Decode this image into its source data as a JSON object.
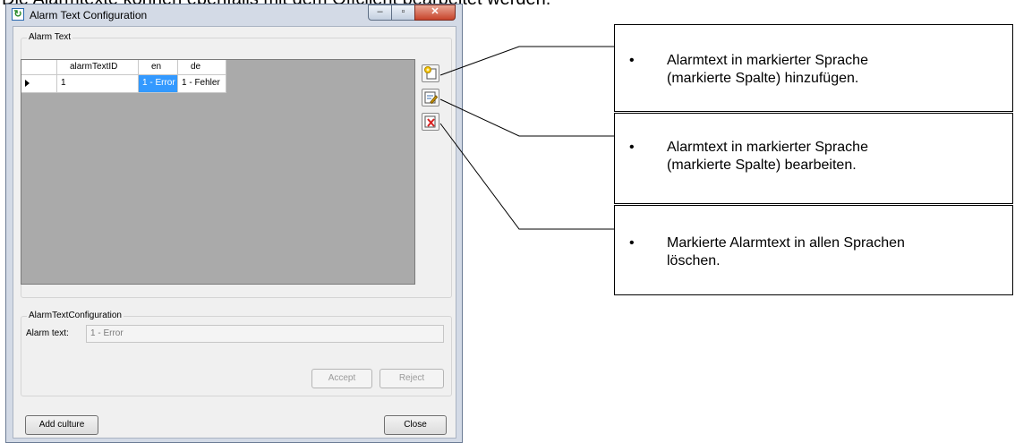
{
  "page_heading": "Die Alarmtexte können ebenfalls mit dem Offclient bearbeitet werden.",
  "window": {
    "title": "Alarm Text Configuration",
    "minimize": "–",
    "maximize": "▫",
    "close": "✕"
  },
  "alarm_text_group": {
    "label": "Alarm Text",
    "columns": [
      "alarmTextID",
      "en",
      "de"
    ],
    "rows": [
      {
        "id": "1",
        "en": "1 - Error",
        "de": "1 - Fehler"
      }
    ]
  },
  "config_group": {
    "label": "AlarmTextConfiguration",
    "alarm_text_label": "Alarm text:",
    "alarm_text_value": "1 - Error",
    "accept": "Accept",
    "reject": "Reject"
  },
  "buttons": {
    "add_culture": "Add culture",
    "close": "Close"
  },
  "callouts": [
    {
      "bullet": "•",
      "line1": "Alarmtext in markierter Sprache",
      "line2": "(markierte Spalte) hinzufügen."
    },
    {
      "bullet": "•",
      "line1": "Alarmtext in markierter Sprache",
      "line2": "(markierte Spalte) bearbeiten."
    },
    {
      "bullet": "•",
      "line1": "Markierte Alarmtext in allen Sprachen",
      "line2": "löschen."
    }
  ]
}
